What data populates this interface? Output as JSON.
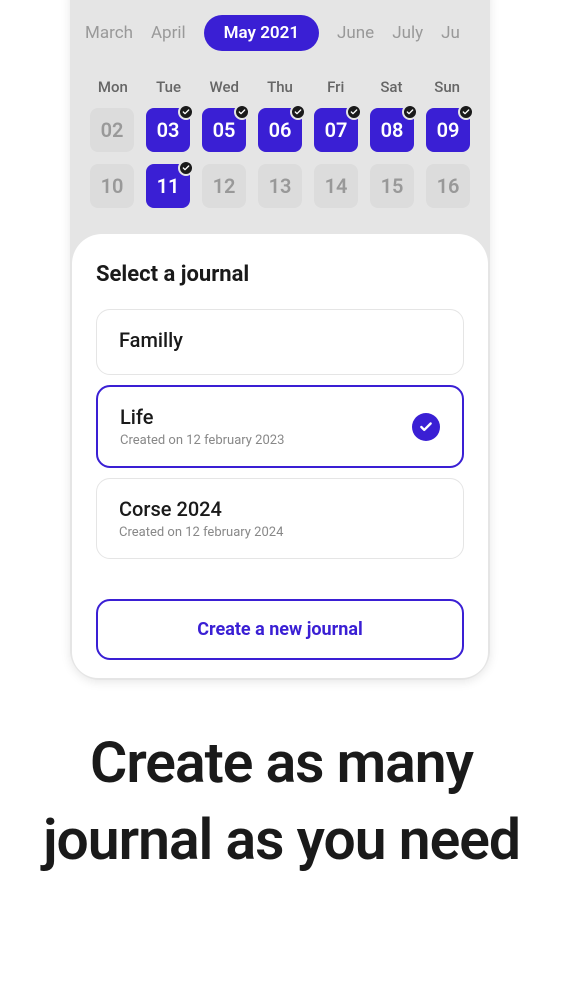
{
  "months": [
    "March",
    "April",
    "May 2021",
    "June",
    "July",
    "Ju"
  ],
  "active_month_index": 2,
  "day_headers": [
    "Mon",
    "Tue",
    "Wed",
    "Thu",
    "Fri",
    "Sat",
    "Sun"
  ],
  "calendar_rows": [
    [
      {
        "day": "02",
        "blue": false,
        "checked": false
      },
      {
        "day": "03",
        "blue": true,
        "checked": true
      },
      {
        "day": "05",
        "blue": true,
        "checked": true
      },
      {
        "day": "06",
        "blue": true,
        "checked": true
      },
      {
        "day": "07",
        "blue": true,
        "checked": true
      },
      {
        "day": "08",
        "blue": true,
        "checked": true
      },
      {
        "day": "09",
        "blue": true,
        "checked": true
      }
    ],
    [
      {
        "day": "10",
        "blue": false,
        "checked": false
      },
      {
        "day": "11",
        "blue": true,
        "checked": true
      },
      {
        "day": "12",
        "blue": false,
        "checked": false
      },
      {
        "day": "13",
        "blue": false,
        "checked": false
      },
      {
        "day": "14",
        "blue": false,
        "checked": false
      },
      {
        "day": "15",
        "blue": false,
        "checked": false
      },
      {
        "day": "16",
        "blue": false,
        "checked": false
      }
    ]
  ],
  "modal": {
    "title": "Select a journal",
    "journals": [
      {
        "name": "Familly",
        "meta": "",
        "selected": false
      },
      {
        "name": "Life",
        "meta": "Created on 12 february 2023",
        "selected": true
      },
      {
        "name": "Corse 2024",
        "meta": "Created on 12 february 2024",
        "selected": false
      }
    ],
    "create_button": "Create a new journal"
  },
  "marketing": "Create as many journal as you need"
}
